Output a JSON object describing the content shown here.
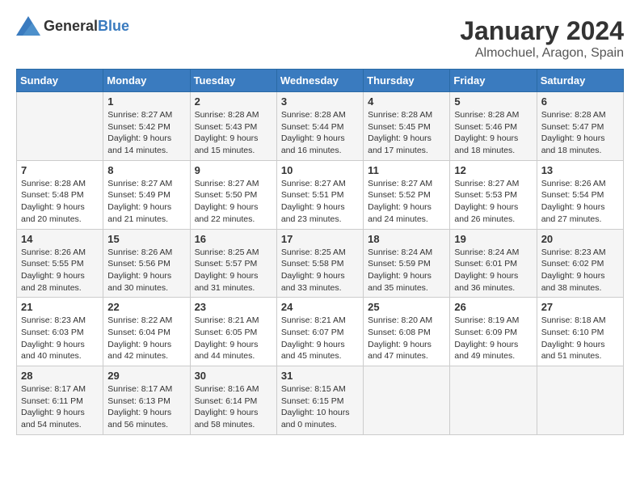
{
  "header": {
    "logo_general": "General",
    "logo_blue": "Blue",
    "title": "January 2024",
    "subtitle": "Almochuel, Aragon, Spain"
  },
  "calendar": {
    "days_of_week": [
      "Sunday",
      "Monday",
      "Tuesday",
      "Wednesday",
      "Thursday",
      "Friday",
      "Saturday"
    ],
    "weeks": [
      [
        {
          "day": "",
          "sunrise": "",
          "sunset": "",
          "daylight": ""
        },
        {
          "day": "1",
          "sunrise": "Sunrise: 8:27 AM",
          "sunset": "Sunset: 5:42 PM",
          "daylight": "Daylight: 9 hours and 14 minutes."
        },
        {
          "day": "2",
          "sunrise": "Sunrise: 8:28 AM",
          "sunset": "Sunset: 5:43 PM",
          "daylight": "Daylight: 9 hours and 15 minutes."
        },
        {
          "day": "3",
          "sunrise": "Sunrise: 8:28 AM",
          "sunset": "Sunset: 5:44 PM",
          "daylight": "Daylight: 9 hours and 16 minutes."
        },
        {
          "day": "4",
          "sunrise": "Sunrise: 8:28 AM",
          "sunset": "Sunset: 5:45 PM",
          "daylight": "Daylight: 9 hours and 17 minutes."
        },
        {
          "day": "5",
          "sunrise": "Sunrise: 8:28 AM",
          "sunset": "Sunset: 5:46 PM",
          "daylight": "Daylight: 9 hours and 18 minutes."
        },
        {
          "day": "6",
          "sunrise": "Sunrise: 8:28 AM",
          "sunset": "Sunset: 5:47 PM",
          "daylight": "Daylight: 9 hours and 18 minutes."
        }
      ],
      [
        {
          "day": "7",
          "sunrise": "Sunrise: 8:28 AM",
          "sunset": "Sunset: 5:48 PM",
          "daylight": "Daylight: 9 hours and 20 minutes."
        },
        {
          "day": "8",
          "sunrise": "Sunrise: 8:27 AM",
          "sunset": "Sunset: 5:49 PM",
          "daylight": "Daylight: 9 hours and 21 minutes."
        },
        {
          "day": "9",
          "sunrise": "Sunrise: 8:27 AM",
          "sunset": "Sunset: 5:50 PM",
          "daylight": "Daylight: 9 hours and 22 minutes."
        },
        {
          "day": "10",
          "sunrise": "Sunrise: 8:27 AM",
          "sunset": "Sunset: 5:51 PM",
          "daylight": "Daylight: 9 hours and 23 minutes."
        },
        {
          "day": "11",
          "sunrise": "Sunrise: 8:27 AM",
          "sunset": "Sunset: 5:52 PM",
          "daylight": "Daylight: 9 hours and 24 minutes."
        },
        {
          "day": "12",
          "sunrise": "Sunrise: 8:27 AM",
          "sunset": "Sunset: 5:53 PM",
          "daylight": "Daylight: 9 hours and 26 minutes."
        },
        {
          "day": "13",
          "sunrise": "Sunrise: 8:26 AM",
          "sunset": "Sunset: 5:54 PM",
          "daylight": "Daylight: 9 hours and 27 minutes."
        }
      ],
      [
        {
          "day": "14",
          "sunrise": "Sunrise: 8:26 AM",
          "sunset": "Sunset: 5:55 PM",
          "daylight": "Daylight: 9 hours and 28 minutes."
        },
        {
          "day": "15",
          "sunrise": "Sunrise: 8:26 AM",
          "sunset": "Sunset: 5:56 PM",
          "daylight": "Daylight: 9 hours and 30 minutes."
        },
        {
          "day": "16",
          "sunrise": "Sunrise: 8:25 AM",
          "sunset": "Sunset: 5:57 PM",
          "daylight": "Daylight: 9 hours and 31 minutes."
        },
        {
          "day": "17",
          "sunrise": "Sunrise: 8:25 AM",
          "sunset": "Sunset: 5:58 PM",
          "daylight": "Daylight: 9 hours and 33 minutes."
        },
        {
          "day": "18",
          "sunrise": "Sunrise: 8:24 AM",
          "sunset": "Sunset: 5:59 PM",
          "daylight": "Daylight: 9 hours and 35 minutes."
        },
        {
          "day": "19",
          "sunrise": "Sunrise: 8:24 AM",
          "sunset": "Sunset: 6:01 PM",
          "daylight": "Daylight: 9 hours and 36 minutes."
        },
        {
          "day": "20",
          "sunrise": "Sunrise: 8:23 AM",
          "sunset": "Sunset: 6:02 PM",
          "daylight": "Daylight: 9 hours and 38 minutes."
        }
      ],
      [
        {
          "day": "21",
          "sunrise": "Sunrise: 8:23 AM",
          "sunset": "Sunset: 6:03 PM",
          "daylight": "Daylight: 9 hours and 40 minutes."
        },
        {
          "day": "22",
          "sunrise": "Sunrise: 8:22 AM",
          "sunset": "Sunset: 6:04 PM",
          "daylight": "Daylight: 9 hours and 42 minutes."
        },
        {
          "day": "23",
          "sunrise": "Sunrise: 8:21 AM",
          "sunset": "Sunset: 6:05 PM",
          "daylight": "Daylight: 9 hours and 44 minutes."
        },
        {
          "day": "24",
          "sunrise": "Sunrise: 8:21 AM",
          "sunset": "Sunset: 6:07 PM",
          "daylight": "Daylight: 9 hours and 45 minutes."
        },
        {
          "day": "25",
          "sunrise": "Sunrise: 8:20 AM",
          "sunset": "Sunset: 6:08 PM",
          "daylight": "Daylight: 9 hours and 47 minutes."
        },
        {
          "day": "26",
          "sunrise": "Sunrise: 8:19 AM",
          "sunset": "Sunset: 6:09 PM",
          "daylight": "Daylight: 9 hours and 49 minutes."
        },
        {
          "day": "27",
          "sunrise": "Sunrise: 8:18 AM",
          "sunset": "Sunset: 6:10 PM",
          "daylight": "Daylight: 9 hours and 51 minutes."
        }
      ],
      [
        {
          "day": "28",
          "sunrise": "Sunrise: 8:17 AM",
          "sunset": "Sunset: 6:11 PM",
          "daylight": "Daylight: 9 hours and 54 minutes."
        },
        {
          "day": "29",
          "sunrise": "Sunrise: 8:17 AM",
          "sunset": "Sunset: 6:13 PM",
          "daylight": "Daylight: 9 hours and 56 minutes."
        },
        {
          "day": "30",
          "sunrise": "Sunrise: 8:16 AM",
          "sunset": "Sunset: 6:14 PM",
          "daylight": "Daylight: 9 hours and 58 minutes."
        },
        {
          "day": "31",
          "sunrise": "Sunrise: 8:15 AM",
          "sunset": "Sunset: 6:15 PM",
          "daylight": "Daylight: 10 hours and 0 minutes."
        },
        {
          "day": "",
          "sunrise": "",
          "sunset": "",
          "daylight": ""
        },
        {
          "day": "",
          "sunrise": "",
          "sunset": "",
          "daylight": ""
        },
        {
          "day": "",
          "sunrise": "",
          "sunset": "",
          "daylight": ""
        }
      ]
    ]
  }
}
